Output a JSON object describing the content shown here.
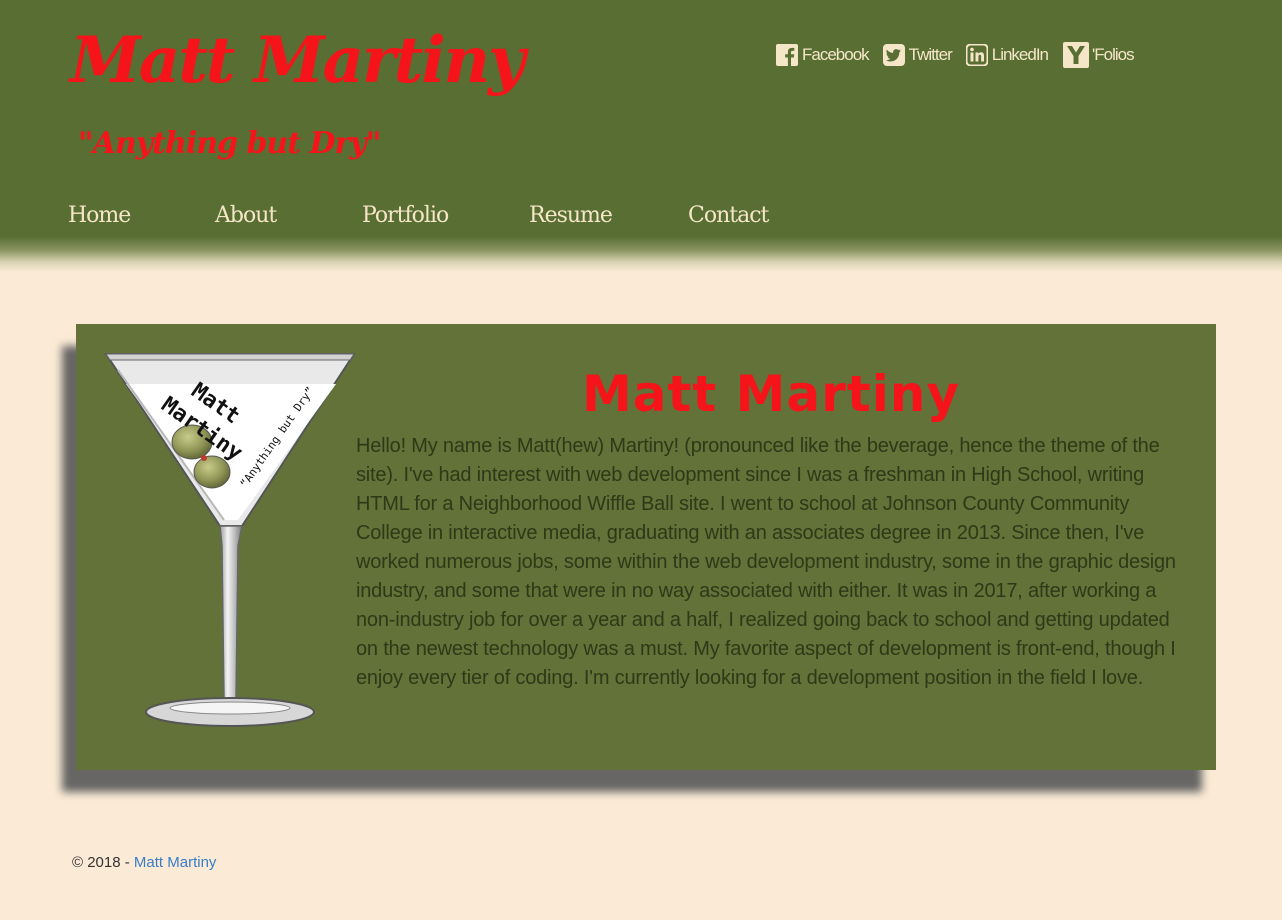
{
  "header": {
    "site_title": "Matt Martiny",
    "tagline": "\"Anything but Dry\""
  },
  "social": [
    {
      "label": "Facebook",
      "icon": "facebook-icon"
    },
    {
      "label": "Twitter",
      "icon": "twitter-icon"
    },
    {
      "label": "LinkedIn",
      "icon": "linkedin-icon"
    },
    {
      "label": "'Folios",
      "icon": "folios-icon"
    }
  ],
  "nav": [
    {
      "label": "Home"
    },
    {
      "label": "About"
    },
    {
      "label": "Portfolio"
    },
    {
      "label": "Resume"
    },
    {
      "label": "Contact"
    }
  ],
  "about": {
    "heading": "Matt Martiny",
    "bio": "Hello! My name is Matt(hew) Martiny! (pronounced like the beverage, hence the theme of the site). I've had interest with web development since I was a freshman in High School, writing HTML for a Neighborhood Wiffle Ball site. I went to school at Johnson County Community College in interactive media, graduating with an associates degree in 2013. Since then, I've worked numerous jobs, some within the web development industry, some in the graphic design industry, and some that were in no way associated with either. It was in 2017, after working a non-industry job for over a year and a half, I realized going back to school and getting updated on the newest technology was a must. My favorite aspect of development is front-end, though I enjoy every tier of coding. I'm currently looking for a development position in the field I love.",
    "logo_text_line1": "Matt",
    "logo_text_line2": "Martiny",
    "logo_tagline": "“Anything but Dry”"
  },
  "footer": {
    "copyright": "© 2018 - ",
    "link_label": "Matt Martiny"
  },
  "colors": {
    "header_bg": "#586e33",
    "card_bg": "#627239",
    "page_bg": "#fbebd6",
    "accent_red": "#f5141a",
    "nav_text": "#f5e6c8",
    "link_blue": "#3a7dc9"
  }
}
